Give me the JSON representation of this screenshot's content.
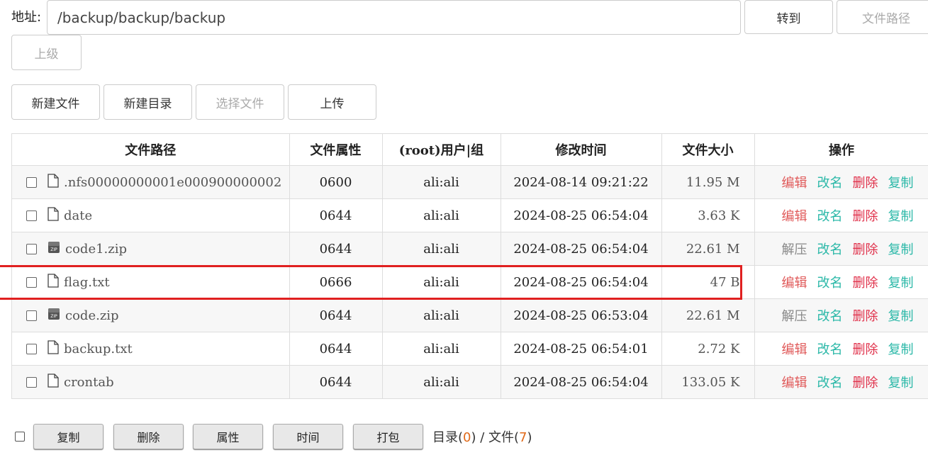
{
  "address": {
    "label": "地址:",
    "value": "/backup/backup/backup",
    "goto_label": "转到",
    "filepath_label": "文件路径",
    "up_label": "上级"
  },
  "toolbar": {
    "new_file": "新建文件",
    "new_dir": "新建目录",
    "choose_file": "选择文件",
    "upload": "上传"
  },
  "table": {
    "headers": {
      "path": "文件路径",
      "perm": "文件属性",
      "owner": "(root)用户|组",
      "mtime": "修改时间",
      "size": "文件大小",
      "ops": "操作"
    },
    "rows": [
      {
        "name": ".nfs00000000001e000900000002",
        "icon": "file-icon",
        "perm": "0600",
        "owner": "ali:ali",
        "mtime": "2024-08-14 09:21:22",
        "size": "11.95 M",
        "op1": "编辑",
        "op2": "改名",
        "op3": "删除",
        "op4": "复制"
      },
      {
        "name": "date",
        "icon": "file-icon",
        "perm": "0644",
        "owner": "ali:ali",
        "mtime": "2024-08-25 06:54:04",
        "size": "3.63 K",
        "op1": "编辑",
        "op2": "改名",
        "op3": "删除",
        "op4": "复制"
      },
      {
        "name": "code1.zip",
        "icon": "zip-icon",
        "perm": "0644",
        "owner": "ali:ali",
        "mtime": "2024-08-25 06:54:04",
        "size": "22.61 M",
        "op1": "解压",
        "op2": "改名",
        "op3": "删除",
        "op4": "复制"
      },
      {
        "name": "flag.txt",
        "icon": "file-icon",
        "perm": "0666",
        "owner": "ali:ali",
        "mtime": "2024-08-25 06:54:04",
        "size": "47 B",
        "op1": "编辑",
        "op2": "改名",
        "op3": "删除",
        "op4": "复制"
      },
      {
        "name": "code.zip",
        "icon": "zip-icon",
        "perm": "0644",
        "owner": "ali:ali",
        "mtime": "2024-08-25 06:53:04",
        "size": "22.61 M",
        "op1": "解压",
        "op2": "改名",
        "op3": "删除",
        "op4": "复制"
      },
      {
        "name": "backup.txt",
        "icon": "file-icon",
        "perm": "0644",
        "owner": "ali:ali",
        "mtime": "2024-08-25 06:54:01",
        "size": "2.72 K",
        "op1": "编辑",
        "op2": "改名",
        "op3": "删除",
        "op4": "复制"
      },
      {
        "name": "crontab",
        "icon": "file-icon",
        "perm": "0644",
        "owner": "ali:ali",
        "mtime": "2024-08-25 06:54:04",
        "size": "133.05 K",
        "op1": "编辑",
        "op2": "改名",
        "op3": "删除",
        "op4": "复制"
      }
    ]
  },
  "bottom": {
    "copy": "复制",
    "delete": "删除",
    "attr": "属性",
    "time": "时间",
    "pack": "打包",
    "dir_label": "目录(",
    "dir_count": "0",
    "mid": ") / 文件(",
    "file_count": "7",
    "end": ")"
  },
  "colors": {
    "highlight": "#e02020",
    "edit": "#e05a5a",
    "rename": "#2bb8a8",
    "delete": "#e0304a"
  }
}
